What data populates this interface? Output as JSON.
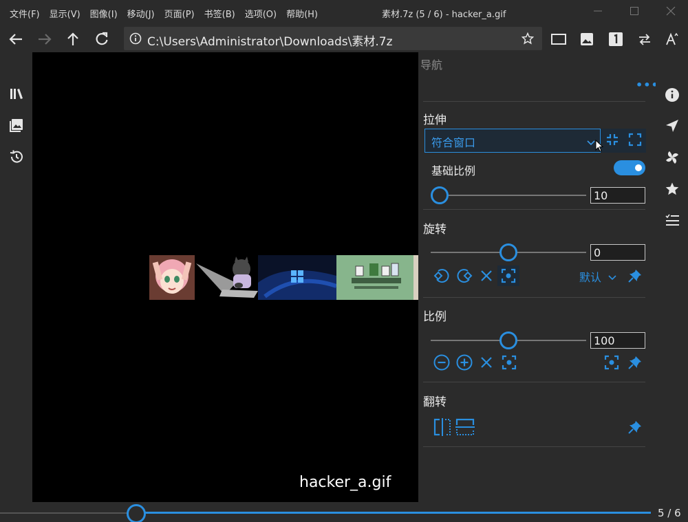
{
  "menu": [
    "文件(F)",
    "显示(V)",
    "图像(I)",
    "移动(J)",
    "页面(P)",
    "书签(B)",
    "选项(O)",
    "帮助(H)"
  ],
  "window_title": "素材.7z (5 / 6) - hacker_a.gif",
  "address": {
    "path": "C:\\Users\\Administrator\\Downloads\\素材.7z"
  },
  "viewer": {
    "filename": "hacker_a.gif"
  },
  "panel": {
    "title": "导航",
    "more": "•••",
    "stretch": {
      "label": "拉伸",
      "value": "符合窗口"
    },
    "base_ratio": {
      "label": "基础比例",
      "enabled": true,
      "value": "10"
    },
    "rotate": {
      "label": "旋转",
      "value": "0",
      "default_label": "默认"
    },
    "scale": {
      "label": "比例",
      "value": "100"
    },
    "flip": {
      "label": "翻转"
    }
  },
  "pager": {
    "text": "5 / 6",
    "current": 5,
    "total": 6
  },
  "colors": {
    "accent": "#2a8fe0",
    "background": "#2b2b2b",
    "viewer": "#000000"
  }
}
